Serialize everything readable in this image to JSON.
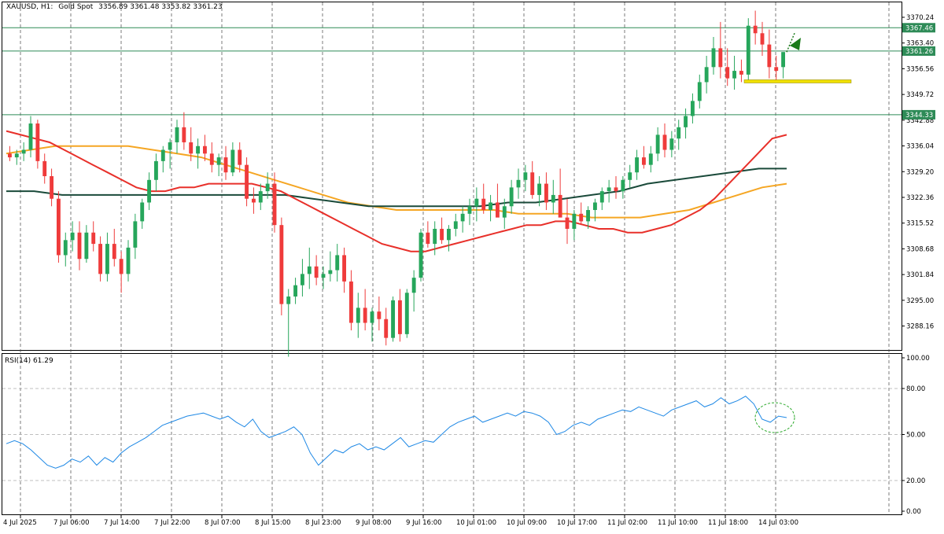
{
  "header": {
    "symbol": "XAUUSD, H1:",
    "instrument": "Gold Spot",
    "ohlc": "3356.89 3361.48 3353.82 3361.23"
  },
  "rsi_header": {
    "label": "RSI(14) 61.29"
  },
  "colors": {
    "bull": "#26a65b",
    "bear": "#ef3b3b",
    "ma_red": "#e8302a",
    "ma_orange": "#f5a623",
    "ma_dark": "#1a4a3a",
    "rsi": "#1e88e5",
    "hline": "#2e8b57",
    "support": "#f0e000"
  },
  "price_axis": {
    "ticks": [
      "3370.24",
      "3363.40",
      "3356.56",
      "3349.72",
      "3342.88",
      "3336.04",
      "3329.20",
      "3322.36",
      "3315.52",
      "3308.68",
      "3301.84",
      "3295.00",
      "3288.16"
    ],
    "badges": [
      "3367.46",
      "3361.26",
      "3344.33"
    ]
  },
  "rsi_axis": {
    "ticks": [
      "100.00",
      "80.00",
      "50.00",
      "20.00",
      "0.00"
    ]
  },
  "time_axis": {
    "labels": [
      "4 Jul 2025",
      "7 Jul 06:00",
      "7 Jul 14:00",
      "7 Jul 22:00",
      "8 Jul 07:00",
      "8 Jul 15:00",
      "8 Jul 23:00",
      "9 Jul 08:00",
      "9 Jul 16:00",
      "10 Jul 01:00",
      "10 Jul 09:00",
      "10 Jul 17:00",
      "11 Jul 02:00",
      "11 Jul 10:00",
      "11 Jul 18:00",
      "14 Jul 03:00"
    ]
  },
  "chart_data": {
    "type": "candlestick",
    "price_range": [
      3282,
      3374
    ],
    "horizontal_levels": [
      3367.46,
      3361.26,
      3344.33
    ],
    "support_level": 3353.2,
    "candles": [
      [
        3334,
        3336,
        3332,
        3333
      ],
      [
        3333,
        3335,
        3331,
        3334
      ],
      [
        3334,
        3337,
        3332,
        3335
      ],
      [
        3335,
        3344,
        3333,
        3342
      ],
      [
        3342,
        3343,
        3330,
        3332
      ],
      [
        3332,
        3334,
        3326,
        3328
      ],
      [
        3328,
        3330,
        3320,
        3322
      ],
      [
        3322,
        3324,
        3305,
        3307
      ],
      [
        3307,
        3313,
        3304,
        3311
      ],
      [
        3311,
        3316,
        3308,
        3313
      ],
      [
        3313,
        3316,
        3303,
        3306
      ],
      [
        3306,
        3315,
        3305,
        3313
      ],
      [
        3313,
        3316,
        3308,
        3310
      ],
      [
        3310,
        3312,
        3300,
        3302
      ],
      [
        3302,
        3313,
        3300,
        3310
      ],
      [
        3310,
        3314,
        3304,
        3306
      ],
      [
        3306,
        3308,
        3297,
        3302
      ],
      [
        3302,
        3311,
        3300,
        3309
      ],
      [
        3309,
        3318,
        3306,
        3316
      ],
      [
        3316,
        3322,
        3314,
        3321
      ],
      [
        3321,
        3329,
        3319,
        3327
      ],
      [
        3327,
        3334,
        3324,
        3332
      ],
      [
        3332,
        3336,
        3329,
        3335
      ],
      [
        3335,
        3338,
        3330,
        3337
      ],
      [
        3337,
        3343,
        3334,
        3341
      ],
      [
        3341,
        3345,
        3335,
        3337
      ],
      [
        3337,
        3341,
        3332,
        3334
      ],
      [
        3334,
        3338,
        3330,
        3336
      ],
      [
        3336,
        3339,
        3332,
        3334
      ],
      [
        3334,
        3337,
        3329,
        3331
      ],
      [
        3331,
        3334,
        3328,
        3333
      ],
      [
        3333,
        3336,
        3327,
        3329
      ],
      [
        3329,
        3337,
        3328,
        3335
      ],
      [
        3335,
        3337,
        3329,
        3331
      ],
      [
        3331,
        3333,
        3320,
        3322
      ],
      [
        3322,
        3325,
        3318,
        3321
      ],
      [
        3321,
        3326,
        3319,
        3324
      ],
      [
        3324,
        3329,
        3322,
        3326
      ],
      [
        3326,
        3329,
        3313,
        3315
      ],
      [
        3315,
        3317,
        3291,
        3294
      ],
      [
        3294,
        3298,
        3280,
        3296
      ],
      [
        3296,
        3301,
        3294,
        3299
      ],
      [
        3299,
        3306,
        3296,
        3302
      ],
      [
        3302,
        3309,
        3298,
        3304
      ],
      [
        3304,
        3307,
        3299,
        3301
      ],
      [
        3301,
        3304,
        3298,
        3302
      ],
      [
        3302,
        3308,
        3300,
        3303
      ],
      [
        3303,
        3310,
        3300,
        3307
      ],
      [
        3307,
        3309,
        3297,
        3300
      ],
      [
        3300,
        3303,
        3287,
        3289
      ],
      [
        3289,
        3297,
        3285,
        3293
      ],
      [
        3293,
        3298,
        3287,
        3289
      ],
      [
        3289,
        3293,
        3284,
        3292
      ],
      [
        3292,
        3296,
        3287,
        3290
      ],
      [
        3290,
        3293,
        3283,
        3285
      ],
      [
        3285,
        3296,
        3284,
        3295
      ],
      [
        3295,
        3298,
        3284,
        3286
      ],
      [
        3286,
        3298,
        3285,
        3297
      ],
      [
        3297,
        3303,
        3292,
        3301
      ],
      [
        3301,
        3314,
        3300,
        3313
      ],
      [
        3313,
        3316,
        3309,
        3310
      ],
      [
        3310,
        3316,
        3307,
        3314
      ],
      [
        3314,
        3317,
        3310,
        3311
      ],
      [
        3311,
        3315,
        3308,
        3314
      ],
      [
        3314,
        3318,
        3312,
        3316
      ],
      [
        3316,
        3320,
        3313,
        3318
      ],
      [
        3318,
        3322,
        3315,
        3320
      ],
      [
        3320,
        3325,
        3316,
        3322
      ],
      [
        3322,
        3326,
        3318,
        3319
      ],
      [
        3319,
        3323,
        3316,
        3321
      ],
      [
        3321,
        3326,
        3318,
        3317
      ],
      [
        3317,
        3322,
        3314,
        3320
      ],
      [
        3320,
        3327,
        3318,
        3325
      ],
      [
        3325,
        3330,
        3322,
        3327
      ],
      [
        3327,
        3331,
        3324,
        3329
      ],
      [
        3329,
        3332,
        3322,
        3323
      ],
      [
        3323,
        3328,
        3320,
        3326
      ],
      [
        3326,
        3329,
        3319,
        3321
      ],
      [
        3321,
        3327,
        3318,
        3323
      ],
      [
        3323,
        3330,
        3320,
        3317
      ],
      [
        3317,
        3322,
        3310,
        3314
      ],
      [
        3314,
        3319,
        3311,
        3318
      ],
      [
        3318,
        3321,
        3315,
        3316
      ],
      [
        3316,
        3320,
        3314,
        3319
      ],
      [
        3319,
        3322,
        3316,
        3321
      ],
      [
        3321,
        3325,
        3319,
        3324
      ],
      [
        3324,
        3327,
        3321,
        3325
      ],
      [
        3325,
        3328,
        3322,
        3324
      ],
      [
        3324,
        3328,
        3322,
        3327
      ],
      [
        3327,
        3331,
        3325,
        3329
      ],
      [
        3329,
        3335,
        3327,
        3333
      ],
      [
        3333,
        3336,
        3330,
        3331
      ],
      [
        3331,
        3336,
        3329,
        3334
      ],
      [
        3334,
        3341,
        3332,
        3339
      ],
      [
        3339,
        3342,
        3333,
        3335
      ],
      [
        3335,
        3340,
        3333,
        3338
      ],
      [
        3338,
        3343,
        3335,
        3341
      ],
      [
        3341,
        3346,
        3338,
        3344
      ],
      [
        3344,
        3350,
        3342,
        3348
      ],
      [
        3348,
        3355,
        3346,
        3353
      ],
      [
        3353,
        3360,
        3350,
        3357
      ],
      [
        3357,
        3365,
        3355,
        3362
      ],
      [
        3362,
        3369,
        3354,
        3357
      ],
      [
        3357,
        3362,
        3352,
        3354
      ],
      [
        3354,
        3360,
        3351,
        3356
      ],
      [
        3356,
        3359,
        3353,
        3355
      ],
      [
        3355,
        3370,
        3353,
        3368
      ],
      [
        3368,
        3372,
        3363,
        3366
      ],
      [
        3366,
        3369,
        3360,
        3363
      ],
      [
        3363,
        3367,
        3354,
        3357
      ],
      [
        3357,
        3360,
        3353,
        3356
      ],
      [
        3357,
        3361,
        3354,
        3361
      ]
    ],
    "ma_red": [
      3340,
      3339,
      3338,
      3337,
      3335,
      3333,
      3331,
      3329,
      3327,
      3325,
      3324,
      3324,
      3325,
      3325,
      3326,
      3326,
      3326,
      3326,
      3325,
      3324,
      3322,
      3320,
      3318,
      3316,
      3314,
      3312,
      3310,
      3309,
      3308,
      3308,
      3309,
      3310,
      3311,
      3312,
      3313,
      3314,
      3315,
      3315,
      3316,
      3316,
      3315,
      3314,
      3314,
      3313,
      3313,
      3314,
      3315,
      3317,
      3319,
      3322,
      3326,
      3330,
      3334,
      3338,
      3339
    ],
    "ma_orange": [
      3334,
      3335,
      3336,
      3336,
      3336,
      3336,
      3335,
      3334,
      3333,
      3331,
      3329,
      3327,
      3325,
      3323,
      3321,
      3320,
      3319,
      3319,
      3319,
      3319,
      3319,
      3318,
      3318,
      3318,
      3317,
      3317,
      3317,
      3318,
      3319,
      3321,
      3323,
      3325,
      3326
    ],
    "ma_dark": [
      3324,
      3324,
      3323,
      3323,
      3323,
      3323,
      3323,
      3323,
      3323,
      3323,
      3323,
      3322,
      3321,
      3320,
      3320,
      3320,
      3320,
      3320,
      3321,
      3321,
      3322,
      3323,
      3324,
      3326,
      3327,
      3328,
      3329,
      3330,
      3330
    ],
    "rsi": [
      44,
      46,
      44,
      40,
      35,
      30,
      28,
      30,
      34,
      32,
      36,
      30,
      35,
      32,
      38,
      42,
      45,
      48,
      52,
      56,
      58,
      60,
      62,
      63,
      64,
      62,
      60,
      62,
      58,
      55,
      60,
      52,
      48,
      50,
      52,
      55,
      50,
      38,
      30,
      35,
      40,
      38,
      42,
      44,
      40,
      42,
      40,
      44,
      48,
      42,
      44,
      46,
      45,
      50,
      55,
      58,
      60,
      62,
      58,
      60,
      62,
      64,
      62,
      65,
      64,
      62,
      58,
      50,
      52,
      56,
      58,
      56,
      60,
      62,
      64,
      66,
      65,
      68,
      66,
      64,
      62,
      66,
      68,
      70,
      72,
      68,
      70,
      74,
      70,
      72,
      75,
      70,
      60,
      58,
      62,
      61
    ]
  }
}
